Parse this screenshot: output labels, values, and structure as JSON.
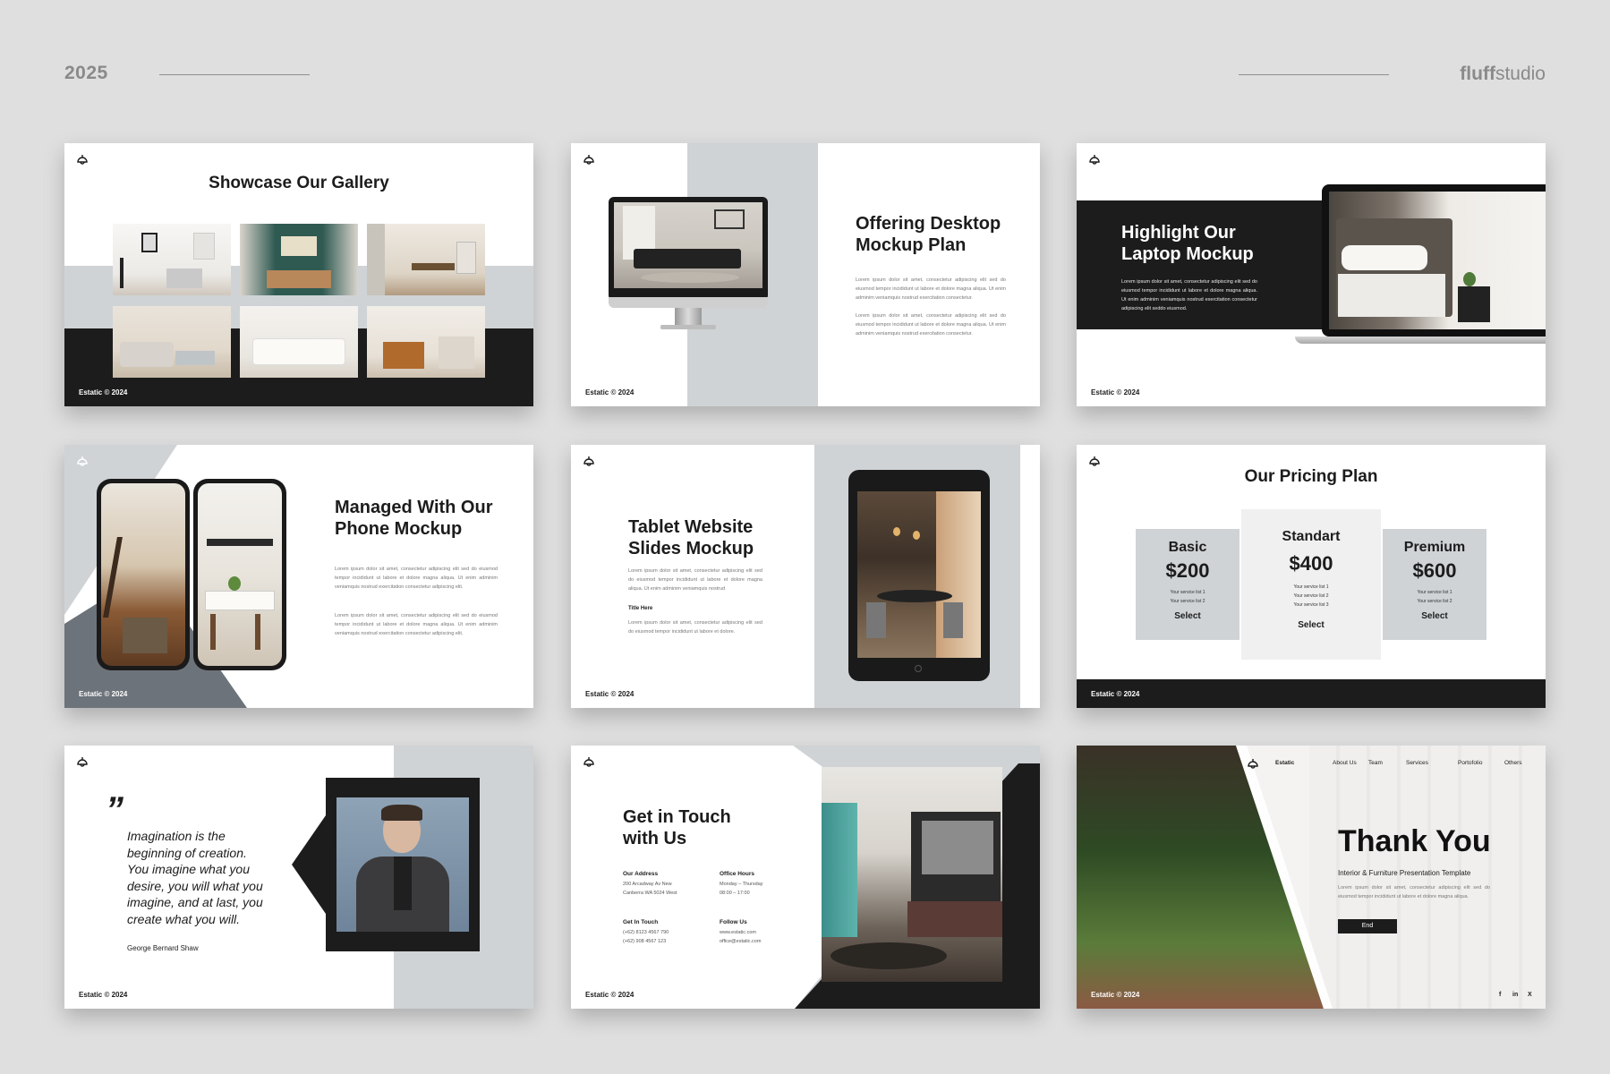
{
  "header": {
    "year": "2025",
    "brand_bold": "fluff",
    "brand_rest": "studio"
  },
  "footer": "Estatic © 2024",
  "slides": {
    "gallery": {
      "title": "Showcase Our Gallery"
    },
    "desktop": {
      "title_line1": "Offering Desktop",
      "title_line2": "Mockup Plan",
      "para1": "Lorem ipsum dolor sit amet, consectetur adipiscing elit sed do eiusmod tempor incididunt ut labore et dolore magna aliqua. Ut enim adminim veniamquis nostrud exercitation consectetur.",
      "para2": "Lorem ipsum dolor sit amet, consectetur adipiscing elit sed do eiusmod tempor incididunt ut labore et dolore magna aliqua. Ut enim adminim veniamquis nostrud exercitation consectetur."
    },
    "laptop": {
      "title_line1": "Highlight Our",
      "title_line2": "Laptop Mockup",
      "para": "Lorem ipsum dolor sit amet, consectetur adipiscing elit sed do eiusmod tempor incididunt ut labore et dolore magna aliqua. Ut enim adminim veniamquis nostrud exercitation consectetur adipiscing elit seddo eiusmod."
    },
    "phone": {
      "title_line1": "Managed With Our",
      "title_line2": "Phone Mockup",
      "para1": "Lorem ipsum dolor sit amet, consectetur adipiscing elit sed do eiusmod tempor incididunt ut labore et dolore magna aliqua. Ut enim adminim veniamquis nostrud exercitation consectetur adipiscing elit.",
      "para2": "Lorem ipsum dolor sit amet, consectetur adipiscing elit sed do eiusmod tempor incididunt ut labore et dolore magna aliqua. Ut enim adminim veniamquis nostrud exercitation consectetur adipiscing elit."
    },
    "tablet": {
      "title_line1": "Tablet Website",
      "title_line2": "Slides Mockup",
      "para1": "Lorem ipsum dolor sit amet, consectetur adipiscing elit sed do eiusmod tempor incididunt ut labore et dolore magna aliqua. Ut enim adminim veniamquis nostrud",
      "subhead": "Title Here",
      "para2": "Lorem ipsum dolor sit amet, consectetur adipiscing elit sed do eiusmod tempor incididunt ut labore et dolore."
    },
    "pricing": {
      "title": "Our Pricing Plan",
      "plans": [
        {
          "name": "Basic",
          "price": "$200",
          "lines": [
            "Your service list 1",
            "Your service list 2"
          ],
          "select": "Select"
        },
        {
          "name": "Standart",
          "price": "$400",
          "lines": [
            "Your service list 1",
            "Your service list 2",
            "Your service list 3"
          ],
          "select": "Select"
        },
        {
          "name": "Premium",
          "price": "$600",
          "lines": [
            "Your service list 1",
            "Your service list 2"
          ],
          "select": "Select"
        }
      ]
    },
    "quote": {
      "mark": "”",
      "line1": "Imagination is the",
      "line2": "beginning of creation.",
      "line3": "You imagine what you",
      "line4": "desire, you will what you",
      "line5": "imagine, and at last, you",
      "line6": "create what you will.",
      "author": "George Bernard Shaw"
    },
    "contact": {
      "title_line1": "Get in Touch",
      "title_line2": "with Us",
      "address_label": "Our Address",
      "address1": "200 Arcadway Av New",
      "address2": "Canberra WA 5024 West",
      "hours_label": "Office Hours",
      "hours1": "Monday – Thursday",
      "hours2": "08:00 – 17:00",
      "touch_label": "Get In Touch",
      "phone1": "(+62) 8123 4567 790",
      "phone2": "(+62) 908 4567 123",
      "follow_label": "Follow Us",
      "web": "www.estatic.com",
      "email": "office@estatic.com"
    },
    "thanks": {
      "nav": [
        "Estatic",
        "About Us",
        "Team",
        "Services",
        "Portofolio",
        "Others"
      ],
      "title": "Thank You",
      "subtitle": "Interior & Furniture Presentation Template",
      "para": "Lorem ipsum dolor sit amet, consectetur adipiscing elit sed do eiusmod tempor incididunt ut labore et dolore magna aliqua.",
      "button": "End",
      "social": [
        "f",
        "in",
        "X"
      ]
    }
  },
  "colors": {
    "dark": "#1c1c1c",
    "grey": "#cfd3d6",
    "slate": "#6d737a",
    "bg": "#dfdfdf"
  }
}
